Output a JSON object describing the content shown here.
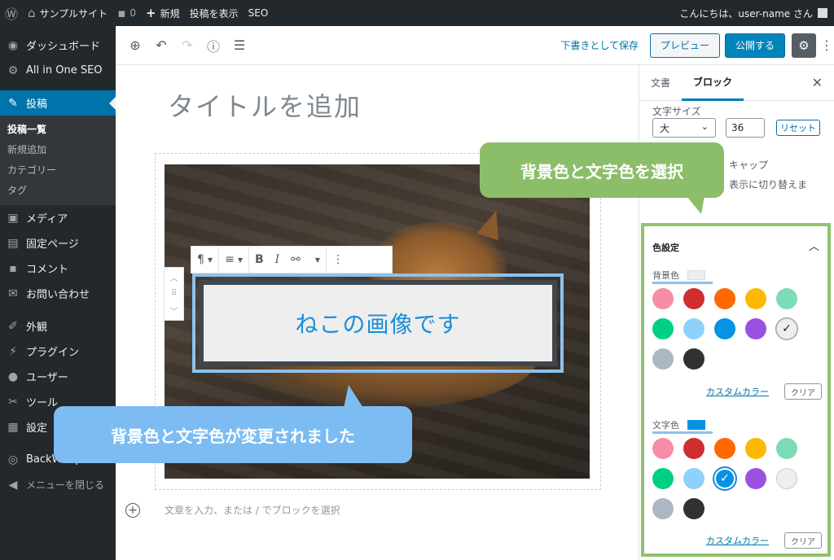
{
  "adminbar": {
    "site_name": "サンプルサイト",
    "comments_count": "0",
    "new_label": "新規",
    "view_post_label": "投稿を表示",
    "seo_label": "SEO",
    "greeting": "こんにちは、user-name さん"
  },
  "menu": {
    "items": [
      {
        "label": "ダッシュボード",
        "icon": "dashboard-icon"
      },
      {
        "label": "All in One SEO",
        "icon": "gear-icon"
      },
      {
        "label": "投稿",
        "icon": "pin-icon"
      },
      {
        "label": "メディア",
        "icon": "media-icon"
      },
      {
        "label": "固定ページ",
        "icon": "page-icon"
      },
      {
        "label": "コメント",
        "icon": "comment-icon"
      },
      {
        "label": "お問い合わせ",
        "icon": "mail-icon"
      },
      {
        "label": "外観",
        "icon": "brush-icon"
      },
      {
        "label": "プラグイン",
        "icon": "plugin-icon"
      },
      {
        "label": "ユーザー",
        "icon": "user-icon"
      },
      {
        "label": "ツール",
        "icon": "wrench-icon"
      },
      {
        "label": "設定",
        "icon": "settings-icon"
      },
      {
        "label": "BackWPup",
        "icon": "backwpup-icon"
      },
      {
        "label": "メニューを閉じる",
        "icon": "collapse-icon"
      }
    ],
    "submenu": [
      "投稿一覧",
      "新規追加",
      "カテゴリー",
      "タグ"
    ]
  },
  "toolbar": {
    "save_draft": "下書きとして保存",
    "preview": "プレビュー",
    "publish": "公開する"
  },
  "editor": {
    "title_placeholder": "タイトルを追加",
    "paragraph_text": "ねこの画像です",
    "appender_placeholder": "文章を入力、または / でブロックを選択"
  },
  "sidebar": {
    "tab_document": "文書",
    "tab_block": "ブロック",
    "font_size_label": "文字サイズ",
    "font_size_select": "大",
    "font_size_value": "36",
    "reset_label": "リセット",
    "partial_text1": "キャップ",
    "partial_text2": "表示に切り替えま",
    "color_settings_title": "色設定",
    "background_label": "背景色",
    "text_color_label": "文字色",
    "custom_color_label": "カスタムカラー",
    "clear_label": "クリア",
    "background_selected_color": "#eeeeee",
    "text_selected_color": "#0693e3",
    "palette": [
      "#f78da7",
      "#cf2e2e",
      "#ff6900",
      "#fcb900",
      "#7bdcb5",
      "#00d084",
      "#8ed1fc",
      "#0693e3",
      "#9b51e0",
      "#eeeeee",
      "#abb8c3",
      "#313131"
    ]
  },
  "callouts": {
    "select_colors": "背景色と文字色を選択",
    "changed": "背景色と文字色が変更されました"
  }
}
